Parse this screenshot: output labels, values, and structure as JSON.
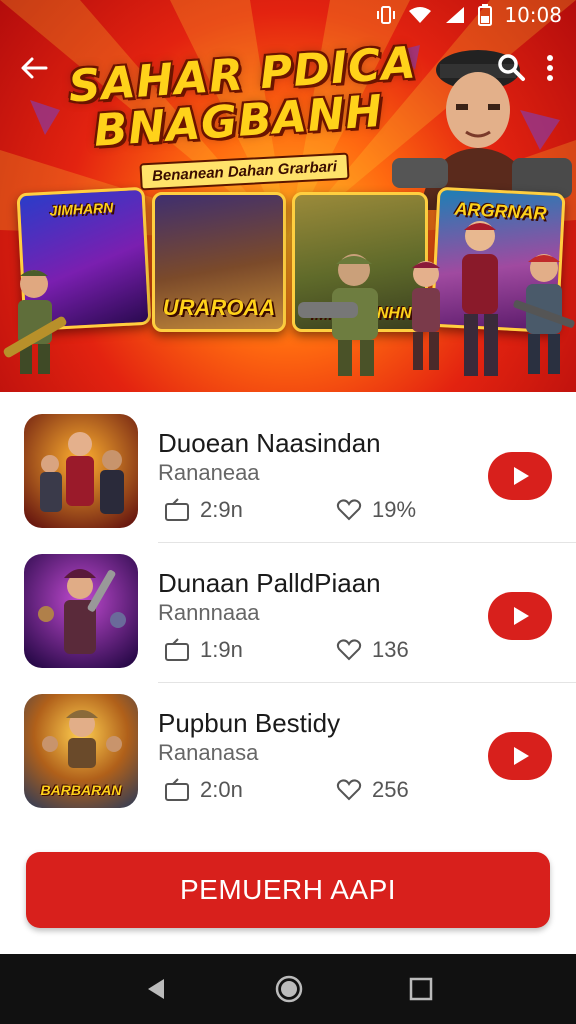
{
  "status_bar": {
    "time": "10:08"
  },
  "banner": {
    "title_line1": "SAHAR PDICA",
    "title_line2": "BNAGBANH",
    "subtitle": "Benanean Dahan  Grarbari",
    "cards": [
      {
        "caption": "JIMHARN"
      },
      {
        "caption": "URAROAA"
      },
      {
        "caption": "IMIDRARNHN"
      },
      {
        "caption": "ARGRNAR"
      }
    ]
  },
  "games": [
    {
      "title": "Duoean Naasindan",
      "subtitle": "Rananeaa",
      "players": "2:9n",
      "likes": "19%"
    },
    {
      "title": "Dunaan PalldPiaan",
      "subtitle": "Rannnaaa",
      "players": "1:9n",
      "likes": "136"
    },
    {
      "title": "Pupbun Bestidy",
      "subtitle": "Rananasa",
      "players": "2:0n",
      "likes": "256",
      "thumb_caption": "BARBARAN"
    }
  ],
  "cta": {
    "label": "PEMUERH AAPI"
  },
  "colors": {
    "accent": "#d8201c",
    "banner_red": "#e32310",
    "banner_yellow": "#ffd21a"
  },
  "icons": [
    "back-arrow-icon",
    "search-icon",
    "more-vert-icon",
    "play-icon",
    "players-icon",
    "heart-icon",
    "nav-back-icon",
    "nav-home-icon",
    "nav-recents-icon"
  ]
}
